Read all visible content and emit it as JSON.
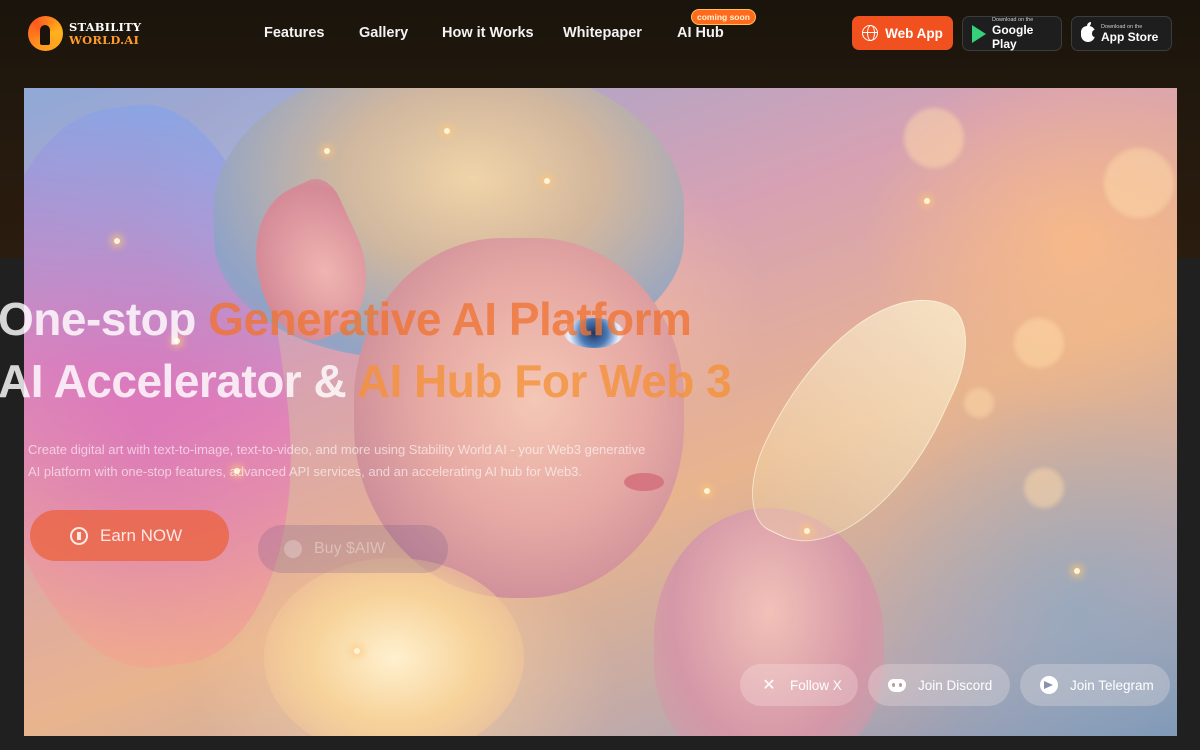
{
  "brand": {
    "line1": "STABILITY",
    "line2": "WORLD.AI"
  },
  "nav": {
    "items": [
      {
        "label": "Features"
      },
      {
        "label": "Gallery"
      },
      {
        "label": "How it Works"
      },
      {
        "label": "Whitepaper"
      },
      {
        "label": "AI Hub"
      }
    ],
    "badge": "coming soon",
    "web_app": "Web App",
    "google_play": {
      "small": "Download on the",
      "big": "Google Play"
    },
    "app_store": {
      "small": "Download on the",
      "big": "App Store"
    }
  },
  "hero": {
    "line1_white": "One-stop ",
    "line1_orange": "Generative AI Platform",
    "line2_white": "AI Accelerator & ",
    "line2_orange": "AI Hub For Web 3",
    "sub1": "Create digital art with text-to-image, text-to-video, and more using Stability World AI - your Web3 generative",
    "sub2": "AI platform with one-stop features, advanced API services, and an accelerating AI hub for Web3.",
    "earn_button": "Earn NOW",
    "buy_button": "Buy $AIW"
  },
  "social": {
    "x": "Follow X",
    "discord": "Join Discord",
    "telegram": "Join Telegram"
  },
  "colors": {
    "accent": "#f1501f",
    "orange_text": "#f07332",
    "background": "#1b1b1b"
  }
}
